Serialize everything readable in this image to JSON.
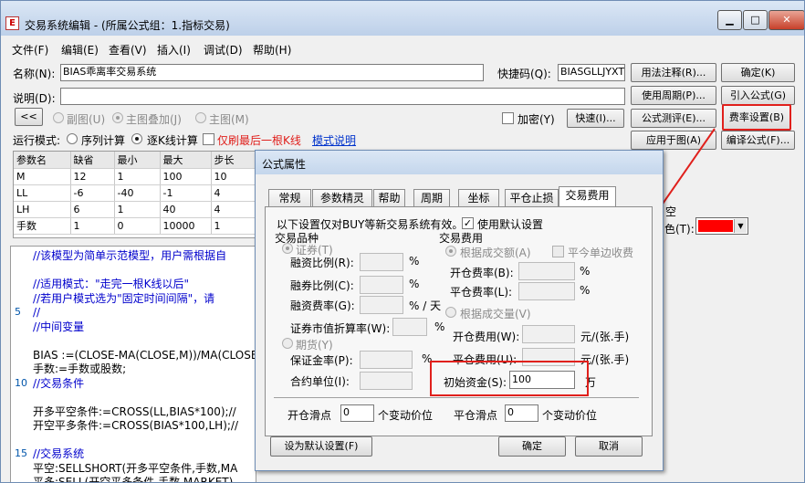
{
  "window": {
    "title": "交易系统编辑 - (所属公式组：1.指标交易)",
    "icon": "app-icon",
    "min": "▁",
    "max": "□",
    "close": "✕"
  },
  "menu": [
    "文件(F)",
    "编辑(E)",
    "查看(V)",
    "插入(I)",
    "调试(D)",
    "帮助(H)"
  ],
  "form": {
    "name_label": "名称(N):",
    "name_value": "BIAS乖离率交易系统",
    "shortcut_label": "快捷码(Q):",
    "shortcut_value": "BIASGLLJYXT",
    "desc_label": "说明(D):",
    "collapse": "<<",
    "chart_opts": [
      "副图(U)",
      "主图叠加(J)",
      "主图(M)"
    ],
    "encrypt": "加密(Y)",
    "fast": "快速(I)...",
    "run_mode_label": "运行模式:",
    "run_modes": [
      "序列计算",
      "逐K线计算"
    ],
    "refresh_last": "仅刷最后一根K线",
    "mode_help": "模式说明"
  },
  "side_buttons": {
    "usage": "用法注释(R)...",
    "ok": "确定(K)",
    "period": "使用周期(P)...",
    "import": "引入公式(G)",
    "test": "公式测评(E)...",
    "fee": "费率设置(B)",
    "apply": "应用于图(A)",
    "compile": "编译公式(F)..."
  },
  "params": {
    "headers": [
      "参数名",
      "缺省",
      "最小",
      "最大",
      "步长"
    ],
    "rows": [
      [
        "M",
        "12",
        "1",
        "100",
        "10"
      ],
      [
        "LL",
        "-6",
        "-40",
        "-1",
        "4"
      ],
      [
        "LH",
        "6",
        "1",
        "40",
        "4"
      ],
      [
        "手数",
        "1",
        "0",
        "10000",
        "1"
      ]
    ]
  },
  "code_lines": [
    {
      "n": "",
      "t": "//该模型为简单示范模型，用户需根据自"
    },
    {
      "n": "",
      "t": ""
    },
    {
      "n": "",
      "t": "//适用模式：\"走完一根K线以后\""
    },
    {
      "n": "",
      "t": "//若用户模式选为\"固定时间间隔\"，请"
    },
    {
      "n": "5",
      "t": "//"
    },
    {
      "n": "",
      "t": "//中间变量"
    },
    {
      "n": "",
      "t": ""
    },
    {
      "n": "",
      "t": "BIAS :=(CLOSE-MA(CLOSE,M))/MA(CLOSE"
    },
    {
      "n": "",
      "t": "手数:=手数或股数;"
    },
    {
      "n": "10",
      "t": "//交易条件"
    },
    {
      "n": "",
      "t": ""
    },
    {
      "n": "",
      "t": "开多平空条件:=CROSS(LL,BIAS*100);//"
    },
    {
      "n": "",
      "t": "开空平多条件:=CROSS(BIAS*100,LH);//"
    },
    {
      "n": "",
      "t": ""
    },
    {
      "n": "15",
      "t": "//交易系统"
    },
    {
      "n": "",
      "t": "平空:SELLSHORT(开多平空条件,手数,MA"
    },
    {
      "n": "",
      "t": "平多:SELL(开空平多条件,手数,MARKET)"
    }
  ],
  "behind_right": {
    "empty": "空",
    "color_label": "色(T):",
    "color_value": "#ff0000"
  },
  "dialog": {
    "title": "公式属性",
    "tabs": [
      "常规",
      "参数精灵",
      "帮助",
      "周期",
      "坐标",
      "平仓止损",
      "交易费用"
    ],
    "note": "以下设置仅对BUY等新交易系统有效。",
    "use_default": "使用默认设置",
    "variety_title": "交易品种",
    "securities": "证券(T)",
    "margin_ratio": "融资比例(R):",
    "short_ratio": "融券比例(C):",
    "margin_fee": "融资费率(G):",
    "pct": "%",
    "pct_day": "% / 天",
    "discount": "证券市值折算率(W):",
    "futures": "期货(Y)",
    "deposit": "保证金率(P):",
    "unit": "合约单位(I):",
    "fee_title": "交易费用",
    "by_amount": "根据成交额(A)",
    "close_today": "平今单边收费",
    "open_rate": "开仓费率(B):",
    "close_rate": "平仓费率(L):",
    "by_volume": "根据成交量(V)",
    "open_fee": "开仓费用(W):",
    "close_fee": "平仓费用(U):",
    "per_lot": "元/(张.手)",
    "initial_capital": "初始资金(S):",
    "initial_value": "100",
    "wan": "万",
    "open_slip": "开仓滑点",
    "open_slip_value": "0",
    "close_slip": "平仓滑点",
    "close_slip_value": "0",
    "tick_unit": "个变动价位",
    "set_default": "设为默认设置(F)",
    "ok": "确定",
    "cancel": "取消",
    "field_values": {
      "zero": "0"
    }
  }
}
